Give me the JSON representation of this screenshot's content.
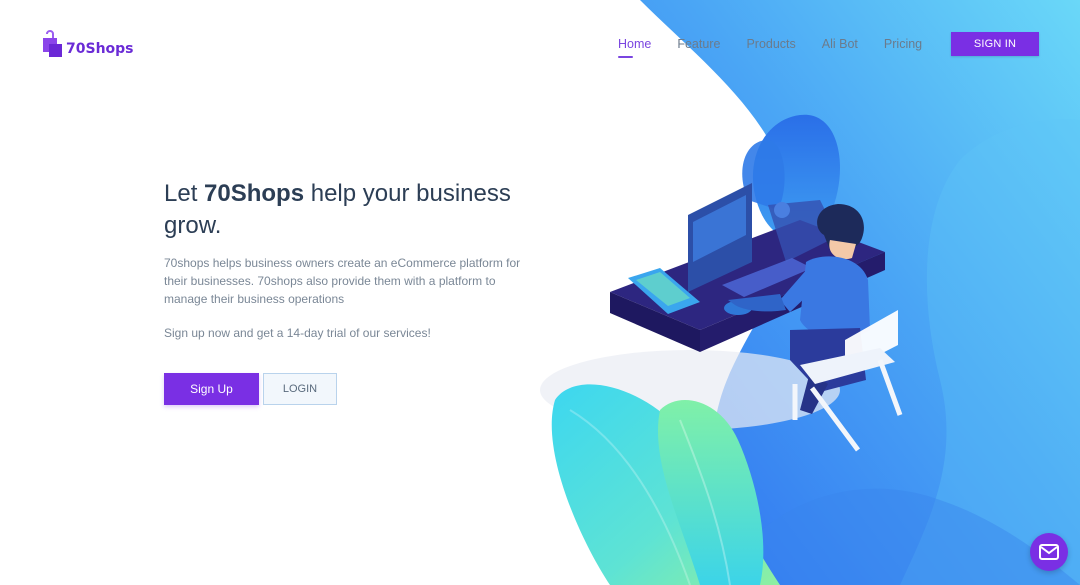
{
  "brand": {
    "name": "70Shops",
    "logo_icon": "shopping-bag-icon",
    "primary_color": "#7a2fe4"
  },
  "nav": {
    "items": [
      {
        "label": "Home",
        "active": true
      },
      {
        "label": "Feature",
        "active": false
      },
      {
        "label": "Products",
        "active": false
      },
      {
        "label": "Ali Bot",
        "active": false
      },
      {
        "label": "Pricing",
        "active": false
      }
    ],
    "signin_label": "SIGN IN"
  },
  "hero": {
    "title_prefix": "Let ",
    "title_brand": "70Shops",
    "title_suffix": " help your business grow.",
    "description": "70shops helps business owners create an eCommerce platform for their businesses. 70shops also provide them with a platform to manage their business operations",
    "trial_text": "Sign up now and get a 14-day trial of our services!",
    "signup_label": "Sign Up",
    "login_label": "LOGIN"
  },
  "illustration": {
    "description_icon": "person-at-laptop-illustration"
  },
  "chat": {
    "icon": "mail-icon"
  }
}
